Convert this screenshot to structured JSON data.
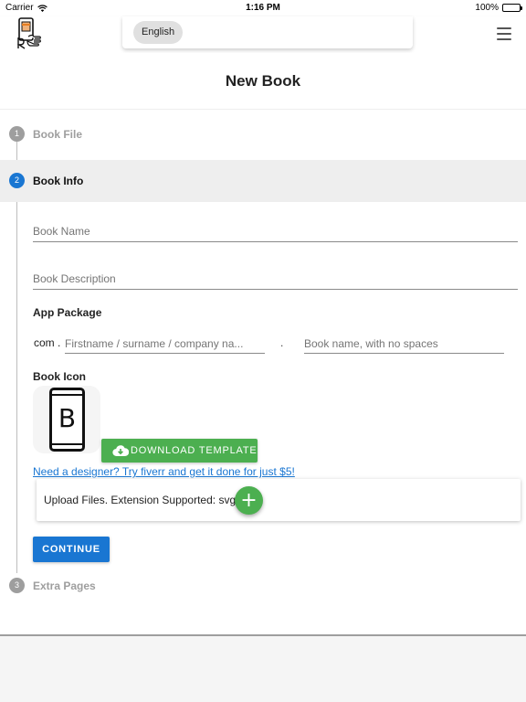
{
  "status_bar": {
    "carrier": "Carrier",
    "time": "1:16 PM",
    "battery": "100%"
  },
  "header": {
    "logo_icon": "book-phone-logo-icon",
    "language": "English",
    "menu_icon": "hamburger-menu-icon"
  },
  "page": {
    "title": "New Book"
  },
  "steps": [
    {
      "number": "1",
      "label": "Book File",
      "active": false
    },
    {
      "number": "2",
      "label": "Book Info",
      "active": true
    },
    {
      "number": "3",
      "label": "Extra Pages",
      "active": false
    }
  ],
  "book_info": {
    "name_placeholder": "Book Name",
    "description_placeholder": "Book Description",
    "app_package_label": "App Package",
    "package_prefix": "com .",
    "package_company_placeholder": "Firstname / surname / company na...",
    "package_separator": ".",
    "package_book_placeholder": "Book name, with no spaces",
    "book_icon_label": "Book Icon",
    "icon_preview_letter": "B",
    "download_template_label": "DOWNLOAD TEMPLATE",
    "designer_link": "Need a designer? Try fiverr and get it done for just $5!",
    "upload_text": "Upload Files. Extension Supported: svg",
    "add_button_label": "+",
    "continue_label": "CONTINUE"
  },
  "colors": {
    "primary": "#1976d2",
    "success": "#4caf50",
    "inactive_step": "#9e9e9e",
    "active_step_bg": "#eeeeee"
  }
}
